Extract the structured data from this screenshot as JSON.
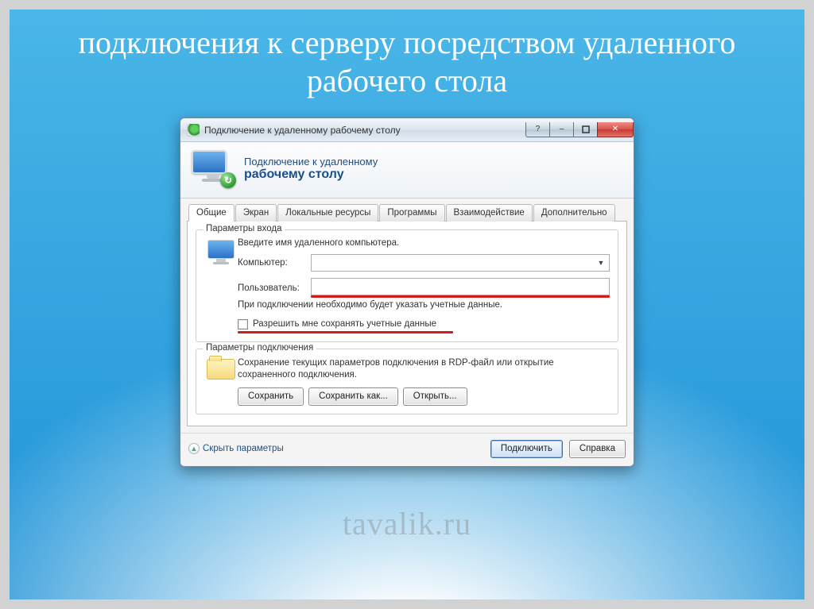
{
  "slide": {
    "title": "подключения к серверу посредством удаленного рабочего стола",
    "watermark": "tavalik.ru"
  },
  "window": {
    "title": "Подключение к удаленному рабочему столу",
    "banner_line1": "Подключение к удаленному",
    "banner_line2": "рабочему столу",
    "tabs": [
      {
        "label": "Общие",
        "active": true
      },
      {
        "label": "Экран",
        "active": false
      },
      {
        "label": "Локальные ресурсы",
        "active": false
      },
      {
        "label": "Программы",
        "active": false
      },
      {
        "label": "Взаимодействие",
        "active": false
      },
      {
        "label": "Дополнительно",
        "active": false
      }
    ],
    "group_login": {
      "legend": "Параметры входа",
      "hint": "Введите имя удаленного компьютера.",
      "computer_label": "Компьютер:",
      "computer_value": "",
      "user_label": "Пользователь:",
      "user_value": "",
      "note": "При подключении необходимо будет указать учетные данные.",
      "checkbox_label": "Разрешить мне сохранять учетные данные"
    },
    "group_conn": {
      "legend": "Параметры подключения",
      "desc": "Сохранение текущих параметров подключения в RDP-файл или открытие сохраненного подключения.",
      "save": "Сохранить",
      "saveas": "Сохранить как...",
      "open": "Открыть..."
    },
    "footer": {
      "hide_params": "Скрыть параметры",
      "connect": "Подключить",
      "help": "Справка"
    },
    "chrome": {
      "help_glyph": "?",
      "min_glyph": "–",
      "close_glyph": "✕"
    }
  }
}
